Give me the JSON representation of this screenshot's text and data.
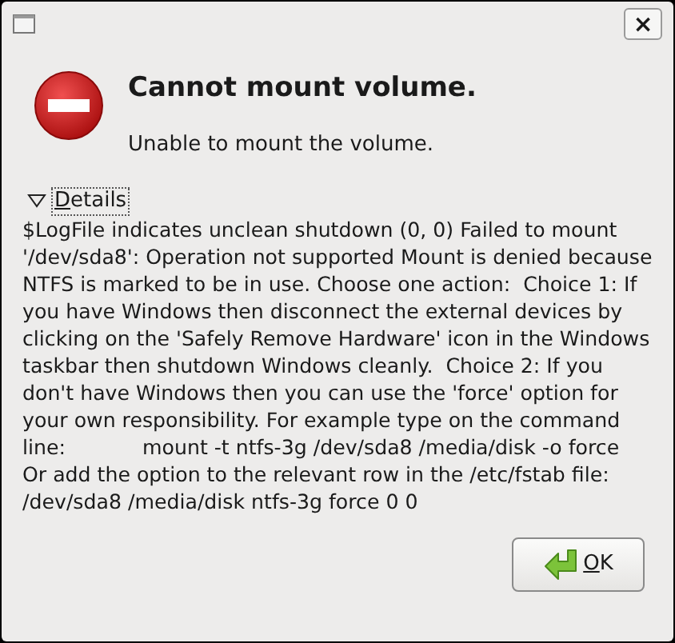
{
  "window": {
    "close_label": "×"
  },
  "message": {
    "kind": "error",
    "title": "Cannot mount volume.",
    "subtitle": "Unable to mount the volume."
  },
  "details": {
    "label": "Details",
    "expanded": true,
    "text": "$LogFile indicates unclean shutdown (0, 0) Failed to mount '/dev/sda8': Operation not supported Mount is denied because NTFS is marked to be in use. Choose one action:  Choice 1: If you have Windows then disconnect the external devices by            clicking on the 'Safely Remove Hardware' icon in the Windows           taskbar then shutdown Windows cleanly.  Choice 2: If you don't have Windows then you can use the 'force' option for           your own responsibility. For example type on the command line:            mount -t ntfs-3g /dev/sda8 /media/disk -o force      Or add the option to the relevant row in the /etc/fstab file:           /dev/sda8 /media/disk ntfs-3g force 0 0"
  },
  "buttons": [
    {
      "label": "OK"
    }
  ]
}
